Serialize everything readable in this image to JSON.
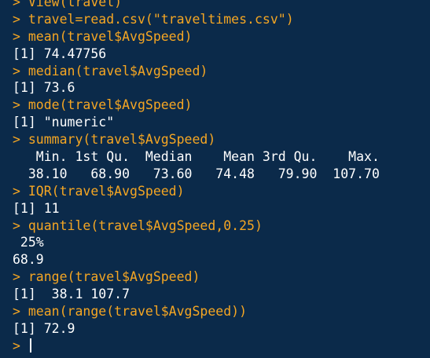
{
  "console": {
    "prompt": ">",
    "lines": [
      {
        "type": "cmd",
        "text": "View(travel)"
      },
      {
        "type": "cmd",
        "text": "travel=read.csv(\"traveltimes.csv\")"
      },
      {
        "type": "cmd",
        "text": "mean(travel$AvgSpeed)"
      },
      {
        "type": "out",
        "text": "[1] 74.47756"
      },
      {
        "type": "cmd",
        "text": "median(travel$AvgSpeed)"
      },
      {
        "type": "out",
        "text": "[1] 73.6"
      },
      {
        "type": "cmd",
        "text": "mode(travel$AvgSpeed)"
      },
      {
        "type": "out",
        "text": "[1] \"numeric\""
      },
      {
        "type": "cmd",
        "text": "summary(travel$AvgSpeed)"
      },
      {
        "type": "out",
        "text": "   Min. 1st Qu.  Median    Mean 3rd Qu.    Max. "
      },
      {
        "type": "out",
        "text": "  38.10   68.90   73.60   74.48   79.90  107.70 "
      },
      {
        "type": "cmd",
        "text": "IQR(travel$AvgSpeed)"
      },
      {
        "type": "out",
        "text": "[1] 11"
      },
      {
        "type": "cmd",
        "text": "quantile(travel$AvgSpeed,0.25)"
      },
      {
        "type": "out",
        "text": " 25% "
      },
      {
        "type": "out",
        "text": "68.9 "
      },
      {
        "type": "cmd",
        "text": "range(travel$AvgSpeed)"
      },
      {
        "type": "out",
        "text": "[1]  38.1 107.7"
      },
      {
        "type": "cmd",
        "text": "mean(range(travel$AvgSpeed))"
      },
      {
        "type": "out",
        "text": "[1] 72.9"
      }
    ],
    "current_input": ""
  }
}
